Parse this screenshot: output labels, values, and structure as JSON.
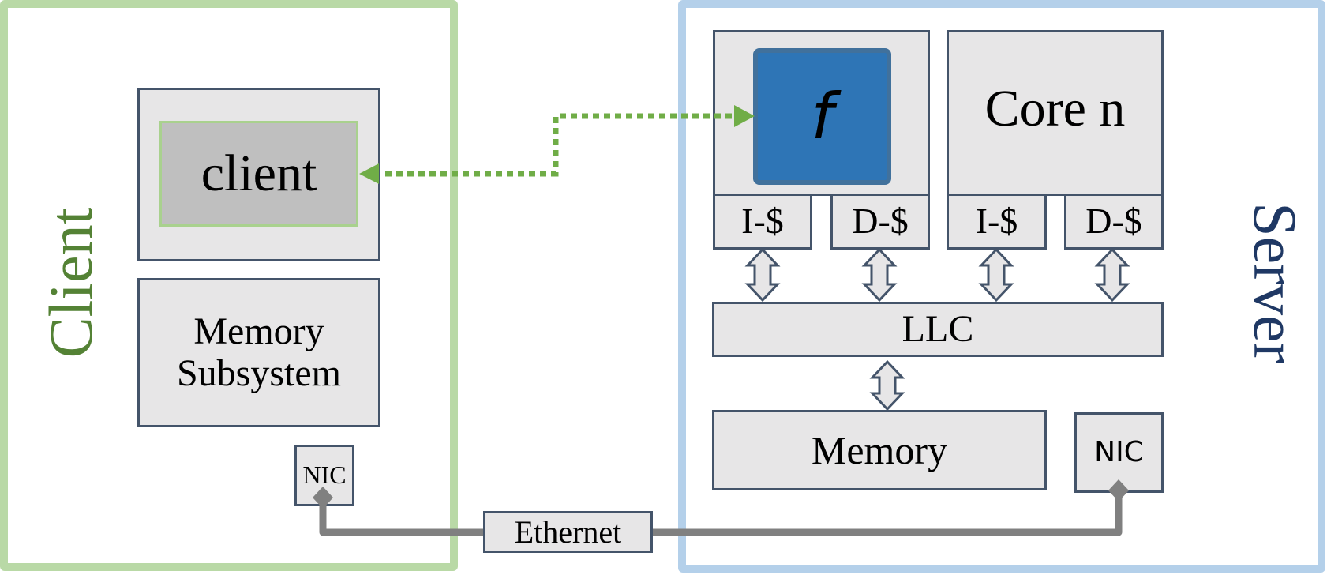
{
  "client": {
    "title": "Client",
    "app_label": "client",
    "memory_label_line1": "Memory",
    "memory_label_line2": "Subsystem",
    "nic_label": "NIC"
  },
  "server": {
    "title": "Server",
    "function_label": "f",
    "core_n_label": "Core n",
    "caches": [
      "I-$",
      "D-$",
      "I-$",
      "D-$"
    ],
    "llc_label": "LLC",
    "memory_label": "Memory",
    "nic_label": "NIC"
  },
  "network": {
    "link_label": "Ethernet"
  },
  "colors": {
    "client_frame": "#b9d9a6",
    "server_frame": "#b4d0ea",
    "client_text": "#548235",
    "server_text": "#1f3864",
    "function_fill": "#2e75b6",
    "request_arrow": "#70ad47",
    "wire": "#808080"
  }
}
